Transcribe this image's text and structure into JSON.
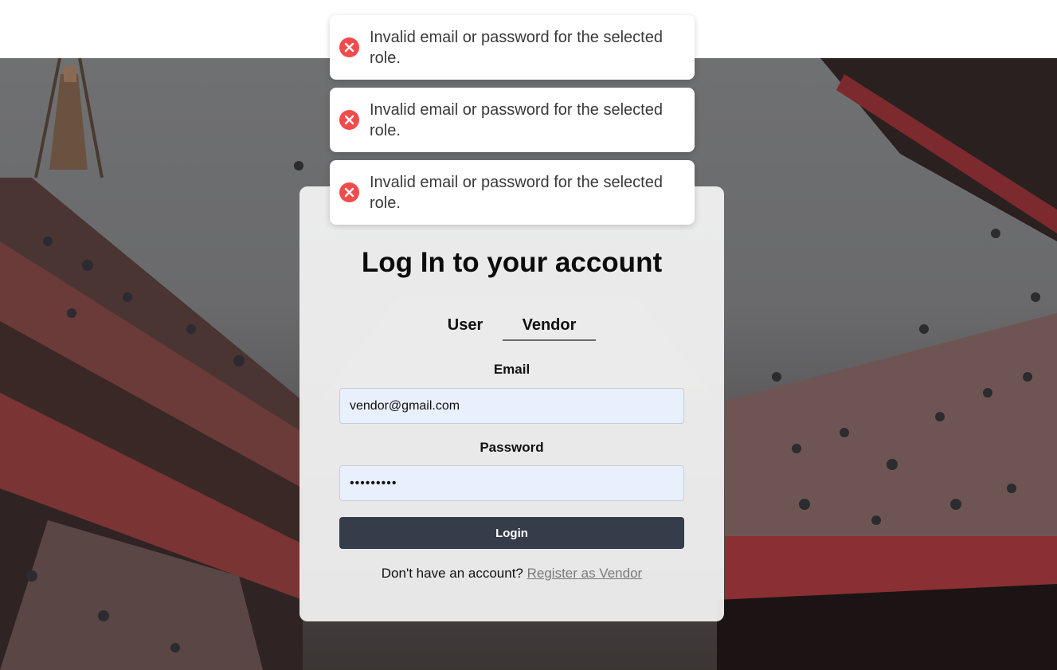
{
  "toasts": [
    {
      "message": "Invalid email or password for the selected role.",
      "icon": "error-circle-icon",
      "color": "#f24b4b"
    },
    {
      "message": "Invalid email or password for the selected role.",
      "icon": "error-circle-icon",
      "color": "#f24b4b"
    },
    {
      "message": "Invalid email or password for the selected role.",
      "icon": "error-circle-icon",
      "color": "#f24b4b"
    }
  ],
  "login": {
    "title": "Log In to your account",
    "tabs": [
      {
        "label": "User",
        "active": false
      },
      {
        "label": "Vendor",
        "active": true
      }
    ],
    "email": {
      "label": "Email",
      "value": "vendor@gmail.com"
    },
    "password": {
      "label": "Password",
      "value": "•••••••••"
    },
    "submit_label": "Login",
    "register_prompt": "Don't have an account?",
    "register_link": "Register as Vendor"
  },
  "colors": {
    "button_bg": "#353c4a",
    "input_bg": "#e8f0fe",
    "error": "#f24b4b",
    "link": "#7a7a7a"
  }
}
